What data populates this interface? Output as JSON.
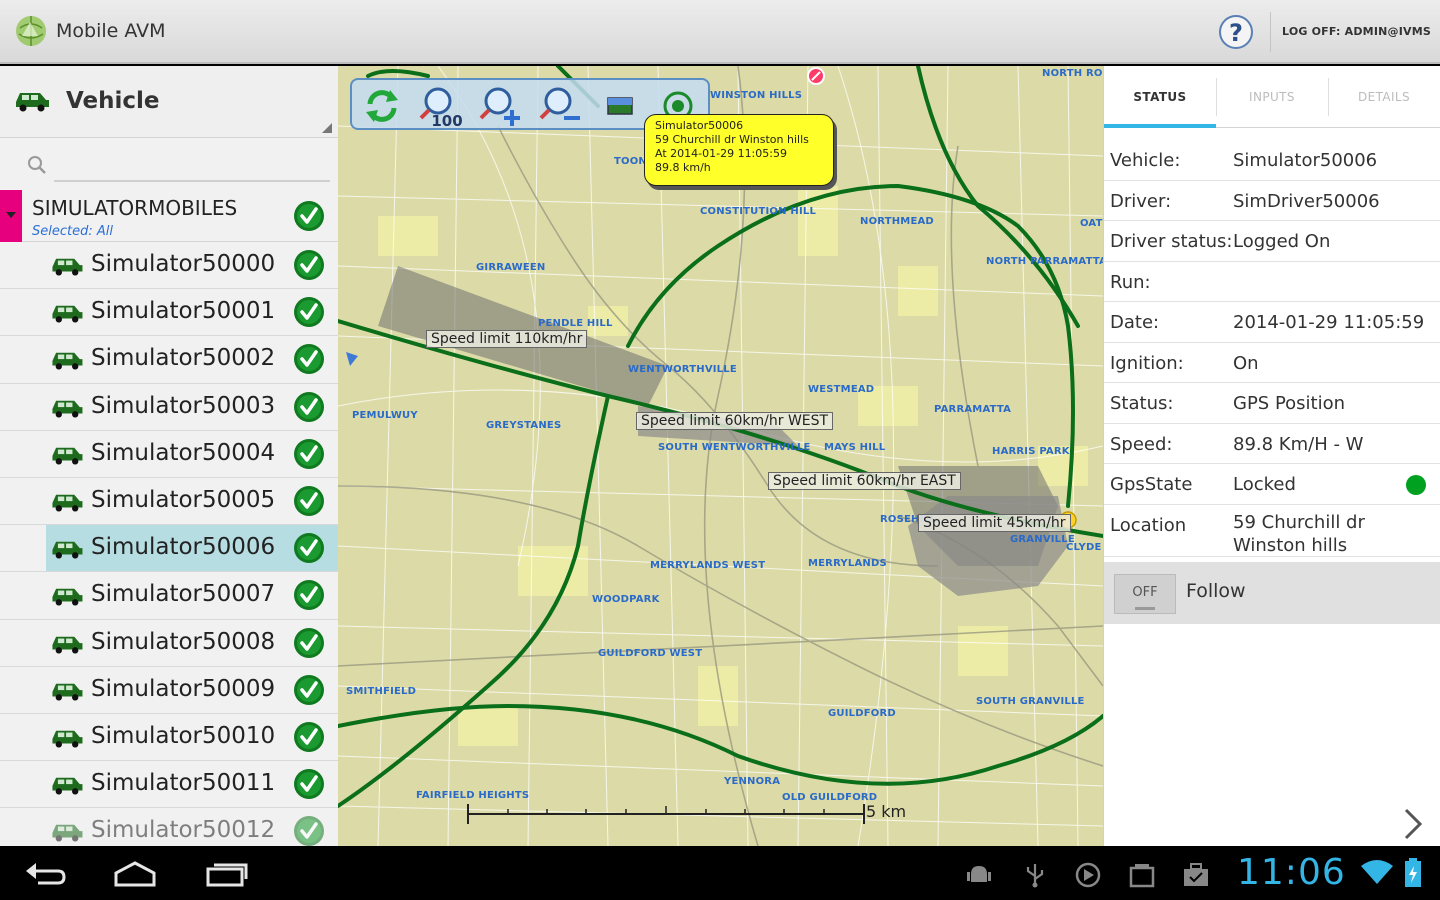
{
  "app": {
    "title": "Mobile AVM",
    "logoff": "LOG OFF: ADMIN@IVMS"
  },
  "left": {
    "header_label": "Vehicle",
    "search_placeholder": "",
    "group": {
      "name": "SIMULATORMOBILES",
      "subtitle": "Selected: All"
    },
    "vehicles": [
      {
        "name": "Simulator50000",
        "selected": false
      },
      {
        "name": "Simulator50001",
        "selected": false
      },
      {
        "name": "Simulator50002",
        "selected": false
      },
      {
        "name": "Simulator50003",
        "selected": false
      },
      {
        "name": "Simulator50004",
        "selected": false
      },
      {
        "name": "Simulator50005",
        "selected": false
      },
      {
        "name": "Simulator50006",
        "selected": true
      },
      {
        "name": "Simulator50007",
        "selected": false
      },
      {
        "name": "Simulator50008",
        "selected": false
      },
      {
        "name": "Simulator50009",
        "selected": false
      },
      {
        "name": "Simulator50010",
        "selected": false
      },
      {
        "name": "Simulator50011",
        "selected": false
      },
      {
        "name": "Simulator50012",
        "selected": false
      }
    ]
  },
  "map": {
    "toolbar": {
      "zoom_100_label": "100"
    },
    "popup": {
      "line1": "Simulator50006",
      "line2": "59 Churchill dr Winston hills",
      "line3": "At 2014-01-29 11:05:59",
      "line4": "89.8 km/h"
    },
    "speed_limits": [
      "Speed limit 110km/hr",
      "Speed limit 60km/hr WEST",
      "Speed limit 60km/hr EAST",
      "Speed limit 45km/hr"
    ],
    "suburbs": [
      "WINSTON HILLS",
      "TOONGABBIE",
      "CONSTITUTION HILL",
      "NORTHMEAD",
      "NORTH PARRAMATTA",
      "GIRRAWEEN",
      "PENDLE HILL",
      "WENTWORTHVILLE",
      "WESTMEAD",
      "PARRAMATTA",
      "PEMULWUY",
      "GREYSTANES",
      "SOUTH WENTWORTHVILLE",
      "MAYS HILL",
      "HARRIS PARK",
      "MERRYLANDS WEST",
      "MERRYLANDS",
      "WOODPARK",
      "GUILDFORD WEST",
      "SMITHFIELD",
      "GUILDFORD",
      "SOUTH GRANVILLE",
      "YENNORA",
      "FAIRFIELD HEIGHTS",
      "OLD GUILDFORD",
      "NORTH ROCKS",
      "OATLANDS",
      "GRANVILLE",
      "CLYDE",
      "ROSEHILL"
    ],
    "scale_label": "5 km"
  },
  "status_panel": {
    "tabs": [
      "STATUS",
      "INPUTS",
      "DETAILS"
    ],
    "rows": [
      {
        "label": "Vehicle:",
        "value": "Simulator50006"
      },
      {
        "label": "Driver:",
        "value": "SimDriver50006"
      },
      {
        "label": "Driver status:",
        "value": "Logged On"
      },
      {
        "label": "Run:",
        "value": ""
      },
      {
        "label": "Date:",
        "value": "2014-01-29 11:05:59"
      },
      {
        "label": "Ignition:",
        "value": "On"
      },
      {
        "label": "Status:",
        "value": "GPS Position"
      },
      {
        "label": "Speed:",
        "value": "89.8 Km/H - W"
      },
      {
        "label": "GpsState",
        "value": "Locked"
      },
      {
        "label": "Location",
        "value": "59 Churchill dr Winston hills"
      }
    ],
    "follow": {
      "toggle_state": "OFF",
      "label": "Follow"
    }
  },
  "system": {
    "clock": "11:06"
  },
  "colors": {
    "accent": "#33b5e5",
    "route": "#0a6e1a",
    "popup": "#ffff2a",
    "group_marker": "#e6007e",
    "selected_row": "#b5dde2"
  }
}
